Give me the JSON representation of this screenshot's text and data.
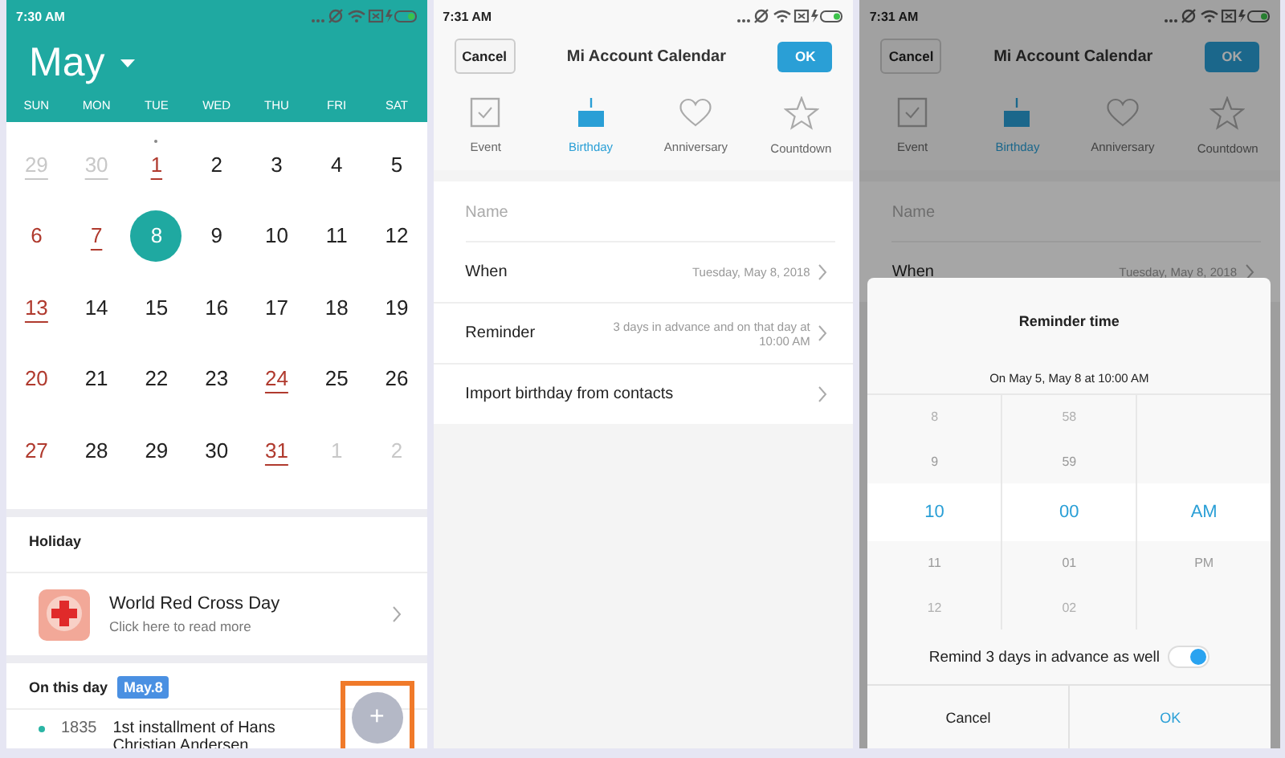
{
  "calendar_screen": {
    "status_time": "7:30 AM",
    "month": "May",
    "weekdays": [
      "SUN",
      "MON",
      "TUE",
      "WED",
      "THU",
      "FRI",
      "SAT"
    ],
    "weeks": [
      [
        {
          "day": "29",
          "kind": "other",
          "underlined": true,
          "marked": false,
          "selected": false
        },
        {
          "day": "30",
          "kind": "other",
          "underlined": true,
          "marked": false,
          "selected": false
        },
        {
          "day": "1",
          "kind": "red",
          "underlined": true,
          "marked": true,
          "selected": false
        },
        {
          "day": "2",
          "kind": "normal",
          "underlined": false,
          "marked": false,
          "selected": false
        },
        {
          "day": "3",
          "kind": "normal",
          "underlined": false,
          "marked": false,
          "selected": false
        },
        {
          "day": "4",
          "kind": "normal",
          "underlined": false,
          "marked": false,
          "selected": false
        },
        {
          "day": "5",
          "kind": "normal",
          "underlined": false,
          "marked": false,
          "selected": false
        }
      ],
      [
        {
          "day": "6",
          "kind": "red",
          "underlined": false,
          "marked": false,
          "selected": false
        },
        {
          "day": "7",
          "kind": "red",
          "underlined": true,
          "marked": false,
          "selected": false
        },
        {
          "day": "8",
          "kind": "normal",
          "underlined": false,
          "marked": false,
          "selected": true
        },
        {
          "day": "9",
          "kind": "normal",
          "underlined": false,
          "marked": false,
          "selected": false
        },
        {
          "day": "10",
          "kind": "normal",
          "underlined": false,
          "marked": false,
          "selected": false
        },
        {
          "day": "11",
          "kind": "normal",
          "underlined": false,
          "marked": false,
          "selected": false
        },
        {
          "day": "12",
          "kind": "normal",
          "underlined": false,
          "marked": false,
          "selected": false
        }
      ],
      [
        {
          "day": "13",
          "kind": "red",
          "underlined": true,
          "marked": false,
          "selected": false
        },
        {
          "day": "14",
          "kind": "normal",
          "underlined": false,
          "marked": false,
          "selected": false
        },
        {
          "day": "15",
          "kind": "normal",
          "underlined": false,
          "marked": false,
          "selected": false
        },
        {
          "day": "16",
          "kind": "normal",
          "underlined": false,
          "marked": false,
          "selected": false
        },
        {
          "day": "17",
          "kind": "normal",
          "underlined": false,
          "marked": false,
          "selected": false
        },
        {
          "day": "18",
          "kind": "normal",
          "underlined": false,
          "marked": false,
          "selected": false
        },
        {
          "day": "19",
          "kind": "normal",
          "underlined": false,
          "marked": false,
          "selected": false
        }
      ],
      [
        {
          "day": "20",
          "kind": "red",
          "underlined": false,
          "marked": false,
          "selected": false
        },
        {
          "day": "21",
          "kind": "normal",
          "underlined": false,
          "marked": false,
          "selected": false
        },
        {
          "day": "22",
          "kind": "normal",
          "underlined": false,
          "marked": false,
          "selected": false
        },
        {
          "day": "23",
          "kind": "normal",
          "underlined": false,
          "marked": false,
          "selected": false
        },
        {
          "day": "24",
          "kind": "red",
          "underlined": true,
          "marked": false,
          "selected": false
        },
        {
          "day": "25",
          "kind": "normal",
          "underlined": false,
          "marked": false,
          "selected": false
        },
        {
          "day": "26",
          "kind": "normal",
          "underlined": false,
          "marked": false,
          "selected": false
        }
      ],
      [
        {
          "day": "27",
          "kind": "red",
          "underlined": false,
          "marked": false,
          "selected": false
        },
        {
          "day": "28",
          "kind": "normal",
          "underlined": false,
          "marked": false,
          "selected": false
        },
        {
          "day": "29",
          "kind": "normal",
          "underlined": false,
          "marked": false,
          "selected": false
        },
        {
          "day": "30",
          "kind": "normal",
          "underlined": false,
          "marked": false,
          "selected": false
        },
        {
          "day": "31",
          "kind": "red",
          "underlined": true,
          "marked": false,
          "selected": false
        },
        {
          "day": "1",
          "kind": "other",
          "underlined": false,
          "marked": false,
          "selected": false
        },
        {
          "day": "2",
          "kind": "other",
          "underlined": false,
          "marked": false,
          "selected": false
        }
      ]
    ],
    "holiday": {
      "heading": "Holiday",
      "title": "World Red Cross Day",
      "subtitle": "Click here to read more"
    },
    "on_this_day": {
      "heading": "On this day",
      "badge": "May.8",
      "items": [
        {
          "year": "1835",
          "text": "1st installment of Hans Christian Andersen"
        }
      ]
    },
    "fab": {
      "label": "+",
      "highlighted": true
    }
  },
  "editor_screens": [
    {
      "status_time": "7:31 AM",
      "cancel": "Cancel",
      "title": "Mi Account Calendar",
      "ok": "OK",
      "dimmed": false,
      "tabs": [
        {
          "label": "Event",
          "kind": "event",
          "selected": false
        },
        {
          "label": "Birthday",
          "kind": "birthday",
          "selected": true
        },
        {
          "label": "Anniversary",
          "kind": "anniversary",
          "selected": false
        },
        {
          "label": "Countdown",
          "kind": "countdown",
          "selected": false
        }
      ],
      "name_placeholder": "Name",
      "rows": [
        {
          "label": "When",
          "value": "Tuesday, May 8, 2018"
        },
        {
          "label": "Reminder",
          "value": "3 days in advance and on that day at 10:00 AM"
        },
        {
          "label": "Import birthday from contacts"
        }
      ]
    },
    {
      "status_time": "7:31 AM",
      "cancel": "Cancel",
      "title": "Mi Account Calendar",
      "ok": "OK",
      "dimmed": true,
      "tabs": [
        {
          "label": "Event",
          "kind": "event",
          "selected": false
        },
        {
          "label": "Birthday",
          "kind": "birthday",
          "selected": true
        },
        {
          "label": "Anniversary",
          "kind": "anniversary",
          "selected": false
        },
        {
          "label": "Countdown",
          "kind": "countdown",
          "selected": false
        }
      ],
      "name_placeholder": "Name",
      "rows": [
        {
          "label": "When",
          "value": "Tuesday, May 8, 2018"
        }
      ],
      "dialog": {
        "title": "Reminder time",
        "subtitle": "On May 5, May 8 at 10:00 AM",
        "columns": [
          [
            {
              "text": "8",
              "selected": false
            },
            {
              "text": "9",
              "selected": false
            },
            {
              "text": "10",
              "selected": true
            },
            {
              "text": "11",
              "selected": false
            },
            {
              "text": "12",
              "selected": false
            }
          ],
          [
            {
              "text": "58",
              "selected": false
            },
            {
              "text": "59",
              "selected": false
            },
            {
              "text": "00",
              "selected": true
            },
            {
              "text": "01",
              "selected": false
            },
            {
              "text": "02",
              "selected": false
            }
          ],
          [
            {
              "text": "AM",
              "selected": true
            },
            {
              "text": "PM",
              "selected": false
            }
          ]
        ],
        "toggle": {
          "label": "Remind 3 days in advance as well",
          "on": true
        },
        "buttons": [
          "Cancel",
          "OK"
        ]
      }
    }
  ]
}
